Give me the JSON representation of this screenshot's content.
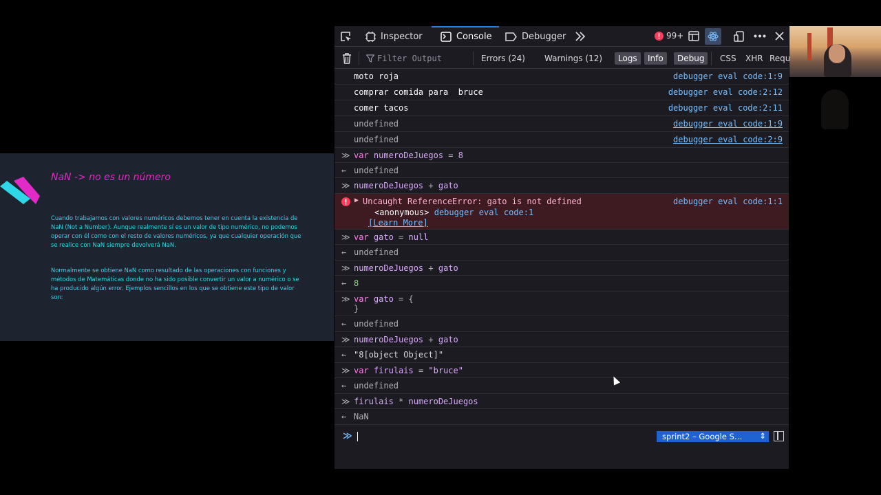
{
  "slide": {
    "title": "NaN -> no es un número",
    "para1": "Cuando trabajamos con valores numéricos debemos tener en cuenta la existencia de NaN (Not a Number). Aunque realmente sí es un valor de tipo numérico, no podemos operar con él como con el resto de valores numéricos, ya que cualquier operación que se realice con NaN siempre devolverá NaN.",
    "para2": "Normalmente se obtiene NaN como resultado de las operaciones con funciones y métodos de Matemáticas donde no ha sido posible convertir un valor a numérico o se ha producido algún error. Ejemplos sencillos en los que se obtiene este tipo de valor son:",
    "colors": {
      "title": "#e22ac7",
      "text": "#2fd6e8",
      "bg": "#1d2430"
    }
  },
  "devtools": {
    "tabs": [
      {
        "label": "Inspector",
        "icon": "inspector-icon"
      },
      {
        "label": "Console",
        "icon": "console-icon",
        "active": true
      },
      {
        "label": "Debugger",
        "icon": "debugger-icon"
      }
    ],
    "error_badge": "99+",
    "filter_placeholder": "Filter Output",
    "filters": {
      "errors": "Errors (24)",
      "warnings": "Warnings (12)",
      "logs": "Logs",
      "info": "Info",
      "debug": "Debug",
      "css": "CSS",
      "xhr": "XHR",
      "requests": "Requ"
    },
    "rows": {
      "r1": {
        "msg": "moto roja",
        "loc": "debugger eval code:1:9"
      },
      "r2": {
        "msg": "comprar comida para  bruce",
        "loc": "debugger eval code:2:12"
      },
      "r3": {
        "msg": "comer tacos",
        "loc": "debugger eval code:2:11"
      },
      "r4": {
        "msg": "undefined",
        "loc": "debugger eval code:1:9"
      },
      "r5": {
        "msg": "undefined",
        "loc": "debugger eval code:2:9"
      },
      "r6": {
        "kw": "var",
        "name": "numeroDeJuegos",
        "op": " = ",
        "val": "8"
      },
      "r7": {
        "msg": "undefined"
      },
      "r8": {
        "a": "numeroDeJuegos",
        "op": " + ",
        "b": "gato"
      },
      "r9": {
        "msg": "Uncaught ReferenceError: gato is not defined",
        "loc": "debugger eval code:1:1",
        "frame": "<anonymous>",
        "frame_loc": "debugger eval code:1",
        "learn": "[Learn More]"
      },
      "r10": {
        "kw": "var",
        "name": "gato",
        "op": " = ",
        "val": "null"
      },
      "r11": {
        "msg": "undefined"
      },
      "r12": {
        "a": "numeroDeJuegos",
        "op": " + ",
        "b": "gato"
      },
      "r13": {
        "msg": "8"
      },
      "r14": {
        "kw": "var",
        "name": "gato",
        "op": " = ",
        "val": "{",
        "line2": "}"
      },
      "r15": {
        "msg": "undefined"
      },
      "r16": {
        "a": "numeroDeJuegos",
        "op": " + ",
        "b": "gato"
      },
      "r17": {
        "msg": "\"8[object Object]\""
      },
      "r18": {
        "kw": "var",
        "name": "firulais",
        "op": " = ",
        "val": "\"bruce\""
      },
      "r19": {
        "msg": "undefined"
      },
      "r20": {
        "a": "firulais",
        "op": " * ",
        "b": "numeroDeJuegos"
      },
      "r21": {
        "msg": "NaN"
      }
    },
    "context_selector": "sprint2 – Google S…"
  }
}
